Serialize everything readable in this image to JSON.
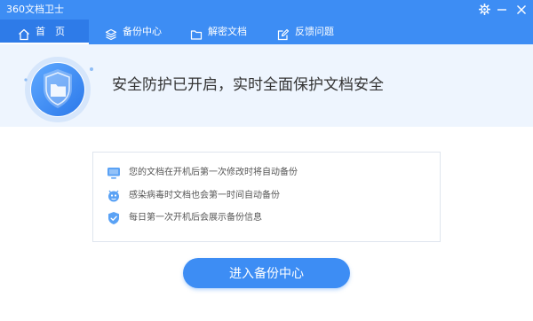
{
  "window": {
    "title": "360文档卫士",
    "accent_color": "#3d8df4",
    "controls": [
      "gear-icon",
      "minimize-icon",
      "close-icon"
    ]
  },
  "tabs": [
    {
      "label": "首　页",
      "icon": "home-icon",
      "active": true
    },
    {
      "label": "备份中心",
      "icon": "layers-icon",
      "active": false
    },
    {
      "label": "解密文档",
      "icon": "folder-icon",
      "active": false
    },
    {
      "label": "反馈问题",
      "icon": "edit-icon",
      "active": false
    }
  ],
  "banner": {
    "status_text": "安全防护已开启，实时全面保护文档安全",
    "icon": "shield-folder-icon"
  },
  "info": {
    "items": [
      {
        "text": "您的文档在开机后第一次修改时将自动备份",
        "icon": "monitor-icon"
      },
      {
        "text": "感染病毒时文档也会第一时间自动备份",
        "icon": "virus-icon"
      },
      {
        "text": "每日第一次开机后会展示备份信息",
        "icon": "shield-check-icon"
      }
    ]
  },
  "cta": {
    "label": "进入备份中心"
  }
}
